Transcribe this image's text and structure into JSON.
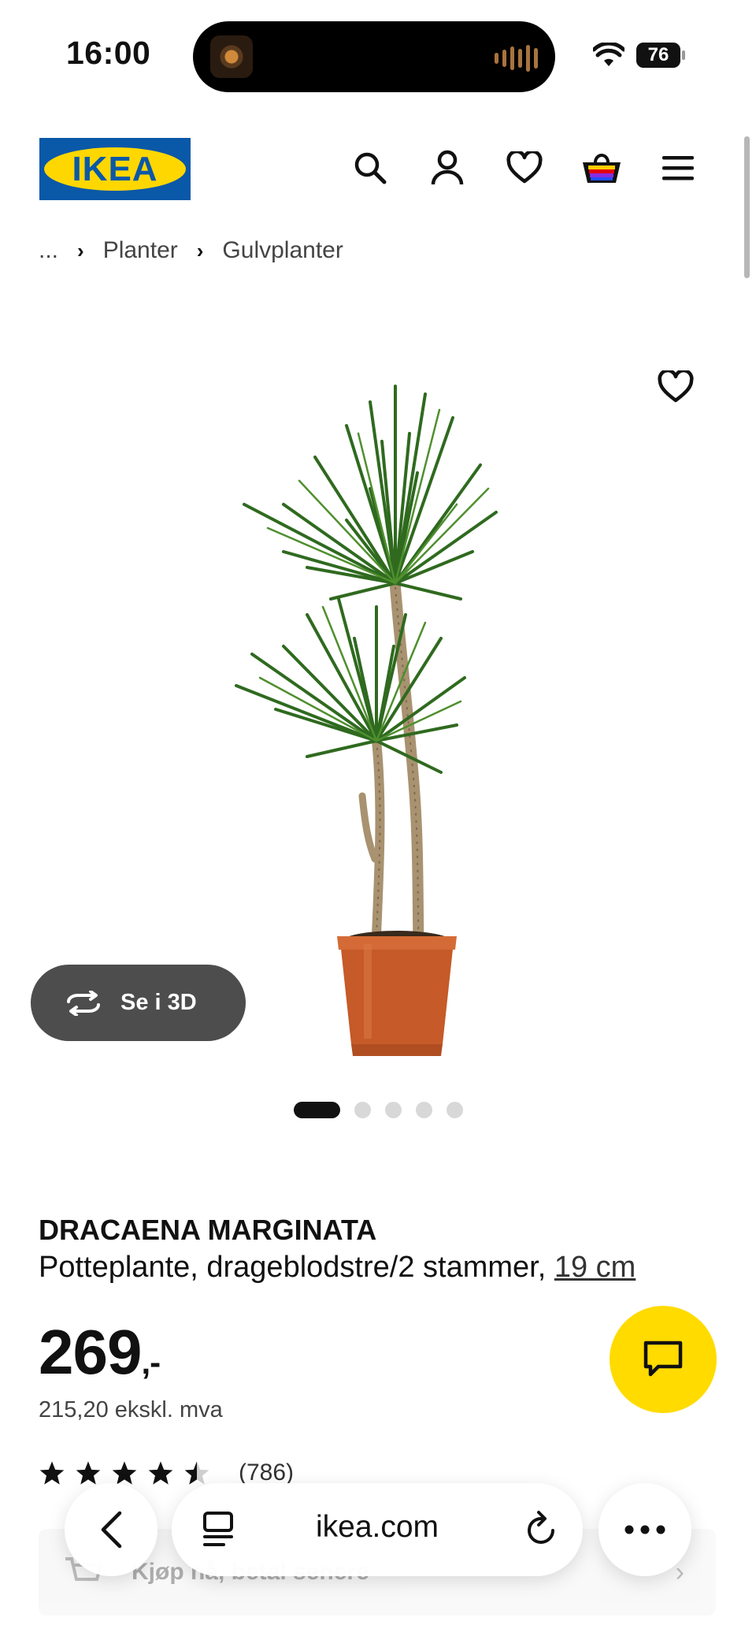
{
  "status_bar": {
    "time": "16:00",
    "battery": "76"
  },
  "header": {
    "logo_text": "IKEA",
    "brand_blue": "#0a58a8",
    "brand_yellow": "#ffd700"
  },
  "breadcrumb": {
    "ellipsis": "...",
    "items": [
      "Planter",
      "Gulvplanter"
    ]
  },
  "product": {
    "view_3d_label": "Se i 3D",
    "image_count": 5,
    "active_image": 1,
    "name": "DRACAENA MARGINATA",
    "description": "Potteplante, drageblodstre/2 stammer,",
    "size_link": "19 cm",
    "price_main": "269",
    "price_suffix": ",-",
    "price_ex_vat": "215,20 ekskl. mva",
    "rating_stars": 4.5,
    "review_count": "(786)"
  },
  "klarna": {
    "text": "Kjøp nå, betal senere"
  },
  "browser": {
    "domain": "ikea.com"
  },
  "icons": [
    "search-icon",
    "account-icon",
    "heart-icon",
    "basket-icon",
    "menu-icon",
    "rotate-3d-icon",
    "chat-icon",
    "back-icon",
    "reader-icon",
    "reload-icon",
    "more-icon"
  ],
  "colors": {
    "chat_button": "#ffdb00",
    "button_3d": "#4d4d4d"
  }
}
